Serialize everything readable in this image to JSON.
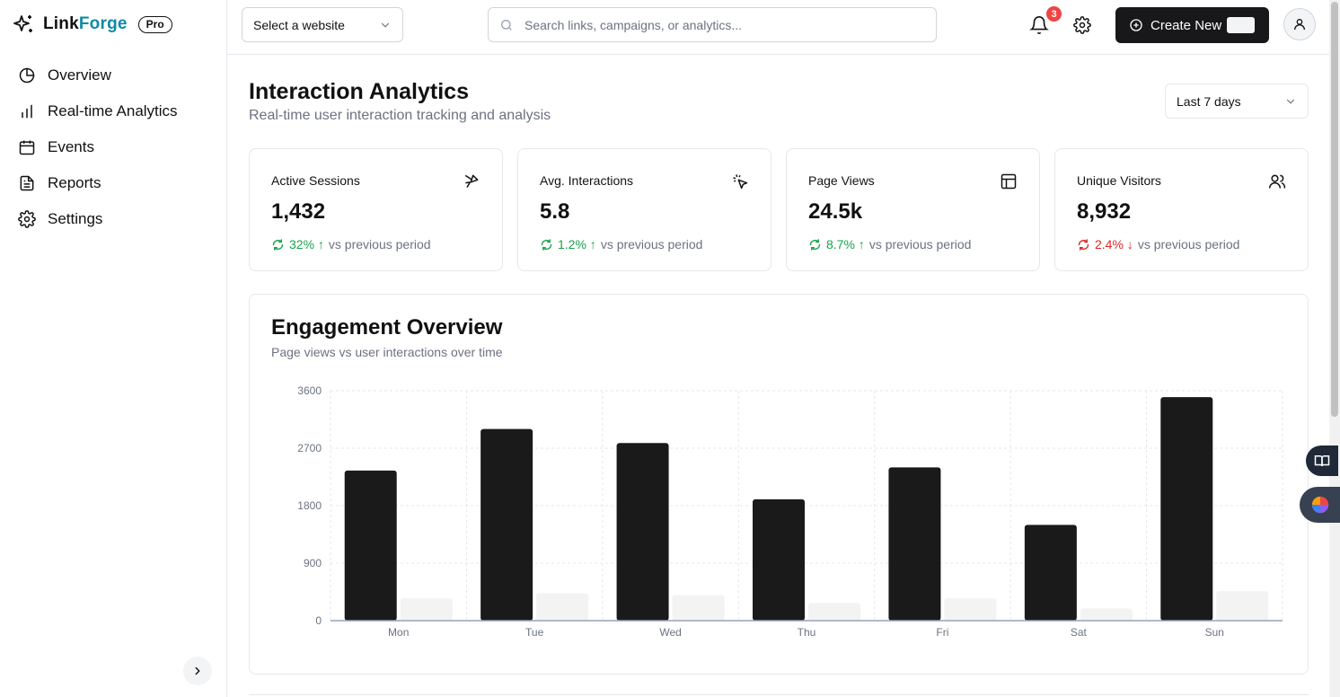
{
  "brand": {
    "name_part1": "Link",
    "name_part2": "Forge",
    "badge": "Pro"
  },
  "sidebar": {
    "items": [
      {
        "label": "Overview",
        "icon": "pie-chart-icon"
      },
      {
        "label": "Real-time Analytics",
        "icon": "bar-chart-icon"
      },
      {
        "label": "Events",
        "icon": "calendar-icon"
      },
      {
        "label": "Reports",
        "icon": "document-icon"
      },
      {
        "label": "Settings",
        "icon": "gear-icon"
      }
    ]
  },
  "topbar": {
    "website_select": "Select a website",
    "search_placeholder": "Search links, campaigns, or analytics...",
    "notification_count": "3",
    "create_label": "Create New"
  },
  "page": {
    "title": "Interaction Analytics",
    "subtitle": "Real-time user interaction tracking and analysis",
    "range": "Last 7 days"
  },
  "stats": [
    {
      "title": "Active Sessions",
      "value": "1,432",
      "change": "32% ↑",
      "direction": "up",
      "suffix": "vs previous period",
      "icon": "pointer-icon"
    },
    {
      "title": "Avg. Interactions",
      "value": "5.8",
      "change": "1.2% ↑",
      "direction": "up",
      "suffix": "vs previous period",
      "icon": "click-icon"
    },
    {
      "title": "Page Views",
      "value": "24.5k",
      "change": "8.7% ↑",
      "direction": "up",
      "suffix": "vs previous period",
      "icon": "layout-icon"
    },
    {
      "title": "Unique Visitors",
      "value": "8,932",
      "change": "2.4% ↓",
      "direction": "down",
      "suffix": "vs previous period",
      "icon": "users-icon"
    }
  ],
  "engagement": {
    "title": "Engagement Overview",
    "subtitle": "Page views vs user interactions over time"
  },
  "colors": {
    "primary_bar": "#1a1a1a",
    "secondary_bar": "#f3f3f3",
    "up": "#16a34a",
    "down": "#dc2626",
    "badge": "#ef4444"
  },
  "chart_data": {
    "type": "bar",
    "categories": [
      "Mon",
      "Tue",
      "Wed",
      "Thu",
      "Fri",
      "Sat",
      "Sun"
    ],
    "series": [
      {
        "values": [
          2350,
          3000,
          2780,
          1900,
          2400,
          1500,
          3500
        ]
      },
      {
        "values": [
          350,
          430,
          400,
          280,
          350,
          190,
          460
        ]
      }
    ],
    "yticks": [
      0,
      900,
      1800,
      2700,
      3600
    ],
    "ylim": [
      0,
      3600
    ],
    "grid": true
  }
}
